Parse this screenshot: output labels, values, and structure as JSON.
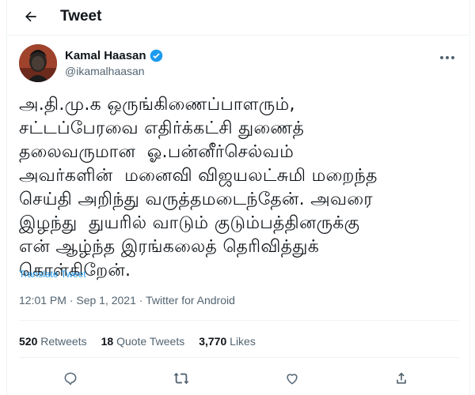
{
  "header": {
    "title": "Tweet",
    "back_icon": "arrow-left-icon"
  },
  "author": {
    "name": "Kamal Haasan",
    "handle": "@ikamalhaasan",
    "verified": true,
    "verified_color": "#1d9bf0"
  },
  "tweet": {
    "text": "அ.தி.மு.க ஒருங்கிணைப்பாளரும்,\nசட்டப்பேரவை எதிர்க்கட்சி துணைத்\nதலைவருமான  ஓ.பன்னீர்செல்வம்\nஅவர்களின்  மனைவி விஜயலட்சுமி மறைந்த\nசெய்தி அறிந்து வருத்தமடைந்தேன். அவரை\nஇழந்து  துயரில் வாடும் குடும்பத்தினருக்கு\nஎன் ஆழ்ந்த இரங்கலைத் தெரிவித்துக்\nகொள்கிறேன்.",
    "translate_label": "Translate Tweet",
    "timestamp": "12:01 PM · Sep 1, 2021 · ",
    "source": "Twitter for Android"
  },
  "stats": {
    "retweets_count": "520",
    "retweets_label": "Retweets",
    "quotes_count": "18",
    "quotes_label": "Quote Tweets",
    "likes_count": "3,770",
    "likes_label": "Likes"
  },
  "actions": [
    "reply-icon",
    "retweet-icon",
    "like-icon",
    "share-icon"
  ],
  "colors": {
    "accent": "#1d9bf0",
    "muted": "#536471",
    "text": "#0f1419",
    "divider": "#eff3f4"
  }
}
